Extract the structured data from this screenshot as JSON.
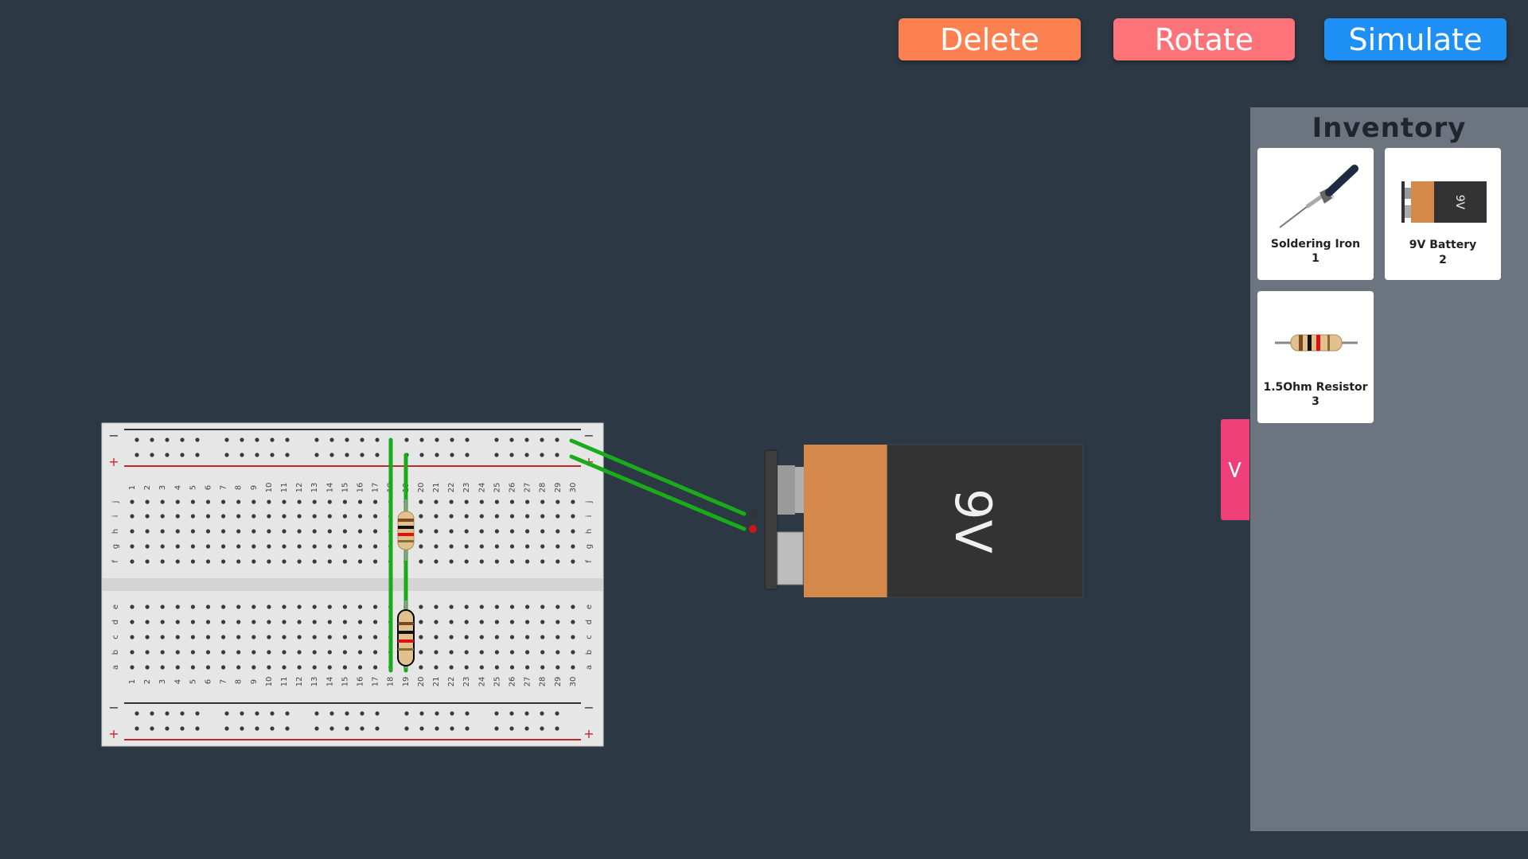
{
  "toolbar": {
    "delete_label": "Delete",
    "rotate_label": "Rotate",
    "simulate_label": "Simulate"
  },
  "inventory": {
    "title": "Inventory",
    "items": [
      {
        "name": "Soldering Iron",
        "count": "1",
        "icon": "soldering-iron-icon"
      },
      {
        "name": "9V Battery",
        "count": "2",
        "icon": "battery-icon"
      },
      {
        "name": "1.5Ohm Resistor",
        "count": "3",
        "icon": "resistor-icon"
      }
    ],
    "toggle_label": ">"
  },
  "battery": {
    "label": "9V",
    "thumb_label": "9V"
  },
  "breadboard": {
    "row_letters_top": [
      "j",
      "i",
      "h",
      "g",
      "f"
    ],
    "row_letters_bottom": [
      "e",
      "d",
      "c",
      "b",
      "a"
    ],
    "rail_minus": "−",
    "rail_plus": "+",
    "columns": [
      "1",
      "2",
      "3",
      "4",
      "5",
      "6",
      "7",
      "8",
      "9",
      "10",
      "11",
      "12",
      "13",
      "14",
      "15",
      "16",
      "17",
      "18",
      "19",
      "20",
      "21",
      "22",
      "23",
      "24",
      "25",
      "26",
      "27",
      "28",
      "29",
      "30"
    ]
  },
  "colors": {
    "background": "#2c3844",
    "delete": "#fd8050",
    "rotate": "#fd7378",
    "simulate": "#1e90f5",
    "toggle": "#ee3f78",
    "wire": "#1aab1a",
    "battery_copper": "#d4884a",
    "battery_body": "#333333"
  }
}
